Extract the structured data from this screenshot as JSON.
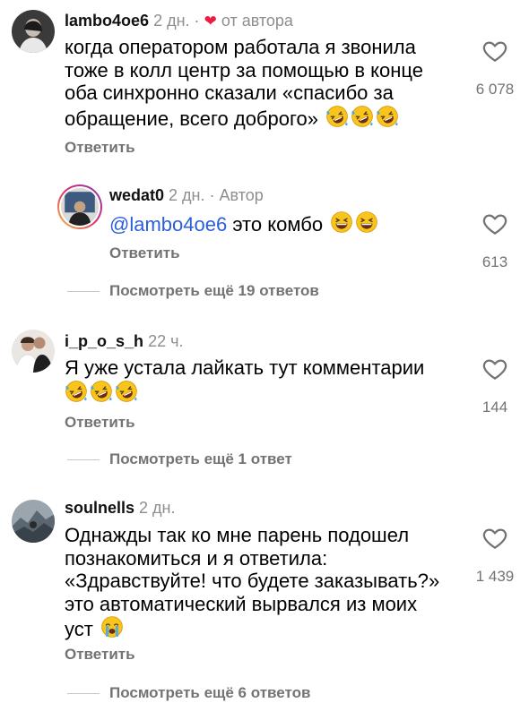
{
  "comments": [
    {
      "username": "lambo4oe6",
      "time": "2 дн.",
      "separator": "·",
      "badge": "от автора",
      "lines": [
        "когда оператором работала я звонила",
        "тоже в колл центр за помощью в конце",
        "оба синхронно сказали «спасибо за",
        "обращение, всего доброго»"
      ],
      "emojis": [
        "rofl",
        "rofl",
        "rofl"
      ],
      "reply": "Ответить",
      "likes": "6 078"
    },
    {
      "username": "wedat0",
      "time": "2 дн.",
      "separator": "·",
      "badge": "Автор",
      "mention": "@lambo4oe6",
      "text": " это комбо",
      "emojis": [
        "grin",
        "grin"
      ],
      "reply": "Ответить",
      "likes": "613"
    },
    {
      "username": "i_p_o_s_h",
      "time": "22 ч.",
      "lines": [
        "Я уже устала лайкать тут комментарии"
      ],
      "emojis": [
        "rofl",
        "rofl",
        "rofl"
      ],
      "reply": "Ответить",
      "likes": "144"
    },
    {
      "username": "soulnells",
      "time": "2 дн.",
      "lines": [
        "Однажды так ко мне парень подошел",
        "познакомиться и я ответила:",
        "«Здравствуйте! что будете заказывать?»",
        "это автоматический вырвался из моих",
        "уст"
      ],
      "emojis": [
        "cry"
      ],
      "reply": "Ответить",
      "likes": "1 439"
    }
  ],
  "view_more": [
    "Посмотреть ещё 19 ответов",
    "Посмотреть ещё 1 ответ",
    "Посмотреть ещё 6 ответов"
  ],
  "icons": {
    "like": "heart-outline-icon",
    "author_badge": "heart-filled-icon",
    "emoji_rofl": "rolling-on-floor-laughing-emoji",
    "emoji_grin": "grinning-squinting-emoji",
    "emoji_cry": "loudly-crying-emoji"
  },
  "colors": {
    "mention": "#2b5fd9",
    "author_heart": "#ed1c45",
    "secondary": "#737373"
  }
}
